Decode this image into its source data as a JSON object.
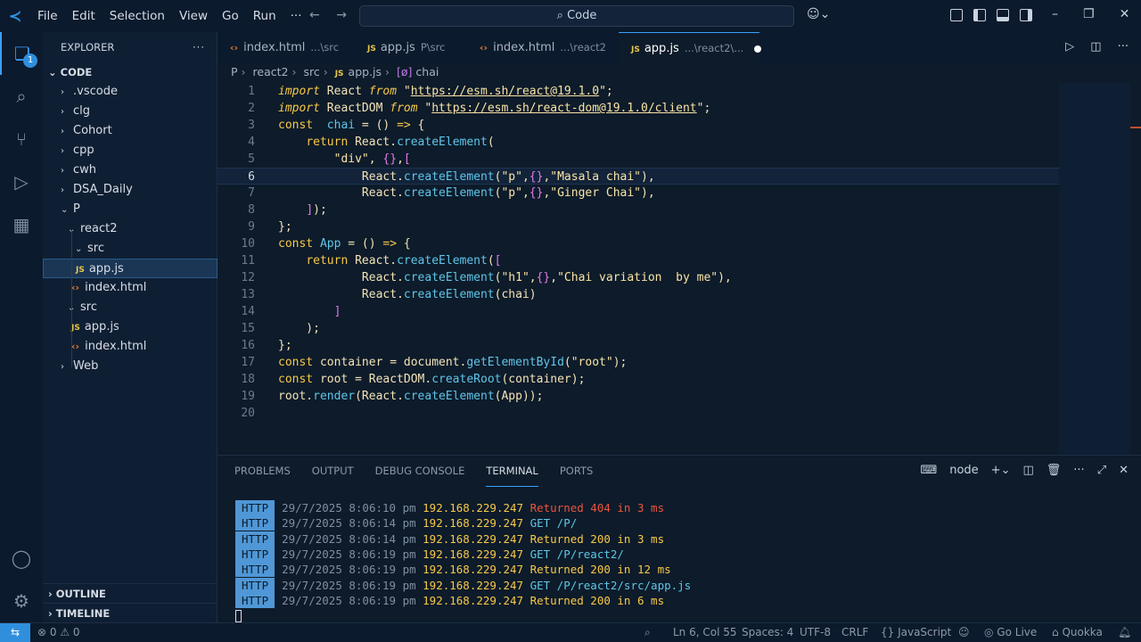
{
  "titlebar": {
    "menu": [
      "File",
      "Edit",
      "Selection",
      "View",
      "Go",
      "Run",
      "···"
    ],
    "search": "Code",
    "back": "←",
    "forward": "→"
  },
  "activity": {
    "explorer_badge": "1"
  },
  "sidebar": {
    "title": "EXPLORER",
    "more": "···",
    "section": "CODE",
    "outline": "OUTLINE",
    "timeline": "TIMELINE",
    "tree": [
      {
        "label": ".vscode",
        "kind": "folder",
        "open": false
      },
      {
        "label": "clg",
        "kind": "folder",
        "open": false
      },
      {
        "label": "Cohort",
        "kind": "folder",
        "open": false
      },
      {
        "label": "cpp",
        "kind": "folder",
        "open": false
      },
      {
        "label": "cwh",
        "kind": "folder",
        "open": false
      },
      {
        "label": "DSA_Daily",
        "kind": "folder",
        "open": false
      },
      {
        "label": "P",
        "kind": "folder",
        "open": true
      },
      {
        "label": "react2",
        "kind": "folder",
        "open": true
      },
      {
        "label": "src",
        "kind": "folder",
        "open": true
      },
      {
        "label": "app.js",
        "kind": "js",
        "selected": true
      },
      {
        "label": "index.html",
        "kind": "html"
      },
      {
        "label": "src",
        "kind": "folder",
        "open": true
      },
      {
        "label": "app.js",
        "kind": "js"
      },
      {
        "label": "index.html",
        "kind": "html"
      },
      {
        "label": "Web",
        "kind": "folder",
        "open": false
      }
    ]
  },
  "tabs": [
    {
      "label": "index.html",
      "desc": "...\\src",
      "kind": "html"
    },
    {
      "label": "app.js",
      "desc": "P\\src",
      "kind": "js"
    },
    {
      "label": "index.html",
      "desc": "...\\react2",
      "kind": "html"
    },
    {
      "label": "app.js",
      "desc": "...\\react2\\...",
      "kind": "js",
      "active": true,
      "dirty": true
    }
  ],
  "breadcrumb": [
    "P",
    "react2",
    "src",
    "app.js",
    "chai"
  ],
  "editor": {
    "current_line": 6,
    "lines": [
      "1",
      "2",
      "3",
      "4",
      "5",
      "6",
      "7",
      "8",
      "9",
      "10",
      "11",
      "12",
      "13",
      "14",
      "15",
      "16",
      "17",
      "18",
      "19",
      "20"
    ]
  },
  "panel": {
    "tabs": [
      "PROBLEMS",
      "OUTPUT",
      "DEBUG CONSOLE",
      "TERMINAL",
      "PORTS"
    ],
    "active_tab": "TERMINAL",
    "shell": "node",
    "log": [
      {
        "tag": "HTTP",
        "time": "29/7/2025 8:06:10 pm",
        "ip": "192.168.229.247",
        "msg": "Returned 404 in 3 ms",
        "type": "r404"
      },
      {
        "tag": "HTTP",
        "time": "29/7/2025 8:06:14 pm",
        "ip": "192.168.229.247",
        "msg": "GET /P/",
        "type": "get"
      },
      {
        "tag": "HTTP",
        "time": "29/7/2025 8:06:14 pm",
        "ip": "192.168.229.247",
        "msg": "Returned 200 in 3 ms",
        "type": "r200"
      },
      {
        "tag": "HTTP",
        "time": "29/7/2025 8:06:19 pm",
        "ip": "192.168.229.247",
        "msg": "GET /P/react2/",
        "type": "get"
      },
      {
        "tag": "HTTP",
        "time": "29/7/2025 8:06:19 pm",
        "ip": "192.168.229.247",
        "msg": "Returned 200 in 12 ms",
        "type": "r200"
      },
      {
        "tag": "HTTP",
        "time": "29/7/2025 8:06:19 pm",
        "ip": "192.168.229.247",
        "msg": "GET /P/react2/src/app.js",
        "type": "get"
      },
      {
        "tag": "HTTP",
        "time": "29/7/2025 8:06:19 pm",
        "ip": "192.168.229.247",
        "msg": "Returned 200 in 6 ms",
        "type": "r200"
      }
    ]
  },
  "status": {
    "errors": "⊗ 0 ⚠ 0",
    "position": "Ln 6, Col 55",
    "spaces": "Spaces: 4",
    "encoding": "UTF-8",
    "eol": "CRLF",
    "language": "{} JavaScript",
    "golive": "Go Live",
    "quokka": "Quokka"
  }
}
